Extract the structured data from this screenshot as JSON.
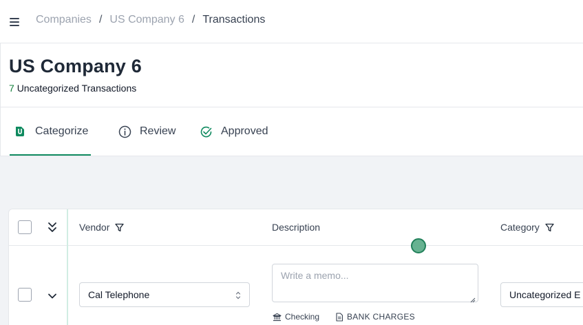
{
  "breadcrumb": {
    "items": [
      "Companies",
      "US Company 6"
    ],
    "separator": "/",
    "current": "Transactions"
  },
  "header": {
    "title": "US Company 6",
    "uncategorized_count": "7",
    "uncategorized_label": "Uncategorized Transactions"
  },
  "tabs": [
    {
      "label": "Categorize",
      "icon": "categorize-tag-icon",
      "active": true
    },
    {
      "label": "Review",
      "icon": "info-circle-icon",
      "active": false
    },
    {
      "label": "Approved",
      "icon": "check-circle-icon",
      "active": false
    }
  ],
  "table": {
    "columns": {
      "vendor": "Vendor",
      "description": "Description",
      "category": "Category"
    },
    "rows": [
      {
        "vendor": "Cal Telephone",
        "memo_value": "",
        "memo_placeholder": "Write a memo...",
        "account": "Checking",
        "transaction_type": "BANK CHARGES",
        "category": "Uncategorized E"
      }
    ]
  },
  "colors": {
    "accent": "#0f8a5f",
    "content_background": "#f1f3f6",
    "muted_text": "#9ca3af"
  }
}
